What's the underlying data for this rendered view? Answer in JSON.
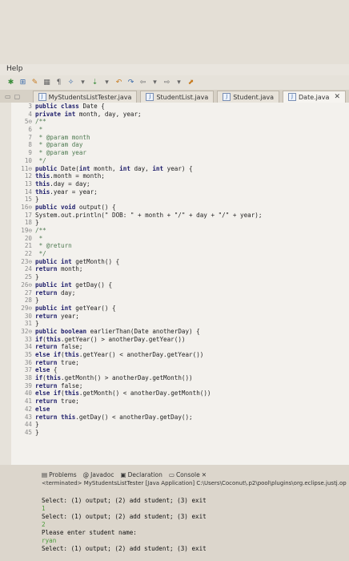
{
  "menubar": {
    "help": "Help"
  },
  "tabs": [
    {
      "label": "MyStudentsListTester.java",
      "active": false
    },
    {
      "label": "StudentList.java",
      "active": false
    },
    {
      "label": "Student.java",
      "active": false
    },
    {
      "label": "Date.java",
      "active": true
    }
  ],
  "code": [
    [
      "3",
      "public class Date {"
    ],
    [
      "4",
      "private int month, day, year;"
    ],
    [
      "5⊖",
      "/**"
    ],
    [
      "6",
      " *"
    ],
    [
      "7",
      " * @param month"
    ],
    [
      "8",
      " * @param day"
    ],
    [
      "9",
      " * @param year"
    ],
    [
      "10",
      " */"
    ],
    [
      "11⊖",
      "public Date(int month, int day, int year) {"
    ],
    [
      "12",
      "this.month = month;"
    ],
    [
      "13",
      "this.day = day;"
    ],
    [
      "14",
      "this.year = year;"
    ],
    [
      "15",
      "}"
    ],
    [
      "16⊖",
      "public void output() {"
    ],
    [
      "17",
      "System.out.println(\" DOB: \" + month + \"/\" + day + \"/\" + year);"
    ],
    [
      "18",
      "}"
    ],
    [
      "19⊖",
      "/**"
    ],
    [
      "20",
      " *"
    ],
    [
      "21",
      " * @return"
    ],
    [
      "22",
      " */"
    ],
    [
      "23⊖",
      "public int getMonth() {"
    ],
    [
      "24",
      "return month;"
    ],
    [
      "25",
      "}"
    ],
    [
      "26⊖",
      "public int getDay() {"
    ],
    [
      "27",
      "return day;"
    ],
    [
      "28",
      "}"
    ],
    [
      "29⊖",
      "public int getYear() {"
    ],
    [
      "30",
      "return year;"
    ],
    [
      "31",
      "}"
    ],
    [
      "32⊖",
      "public boolean earlierThan(Date anotherDay) {"
    ],
    [
      "33",
      "if(this.getYear() > anotherDay.getYear())"
    ],
    [
      "34",
      "return false;"
    ],
    [
      "35",
      "else if(this.getYear() < anotherDay.getYear())"
    ],
    [
      "36",
      "return true;"
    ],
    [
      "37",
      "else {"
    ],
    [
      "38",
      "if(this.getMonth() > anotherDay.getMonth())"
    ],
    [
      "39",
      "return false;"
    ],
    [
      "40",
      "else if(this.getMonth() < anotherDay.getMonth())"
    ],
    [
      "41",
      "return true;"
    ],
    [
      "42",
      "else"
    ],
    [
      "43",
      "return this.getDay() < anotherDay.getDay();"
    ],
    [
      "44",
      "}"
    ],
    [
      "45",
      "}"
    ]
  ],
  "console": {
    "tabs": [
      "Problems",
      "Javadoc",
      "Declaration",
      "Console"
    ],
    "status": "<terminated> MyStudentsListTester [Java Application] C:\\Users\\Coconut\\.p2\\pool\\plugins\\org.eclipse.justj.op",
    "lines": [
      {
        "text": "",
        "user": false
      },
      {
        "text": "Select: (1) output; (2) add student; (3) exit",
        "user": false
      },
      {
        "text": "1",
        "user": true
      },
      {
        "text": "Select: (1) output; (2) add student; (3) exit",
        "user": false
      },
      {
        "text": "2",
        "user": true
      },
      {
        "text": "Please enter student name:",
        "user": false
      },
      {
        "text": "ryan",
        "user": true
      },
      {
        "text": "Select: (1) output; (2) add student; (3) exit",
        "user": false
      }
    ]
  }
}
